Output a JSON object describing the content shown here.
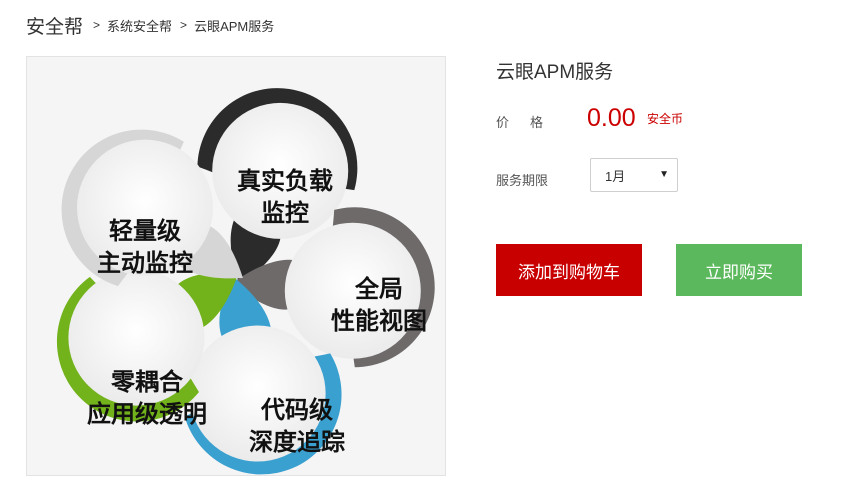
{
  "breadcrumb": {
    "home": "安全帮",
    "separator": ">",
    "category": "系统安全帮",
    "current": "云眼APM服务"
  },
  "product_image": {
    "petals": [
      {
        "line1": "真实负载",
        "line2": "监控",
        "ring_color": "#2b2b2b"
      },
      {
        "line1": "全局",
        "line2": "性能视图",
        "ring_color": "#6e6a6a"
      },
      {
        "line1": "代码级",
        "line2": "深度追踪",
        "ring_color": "#3aa0d0"
      },
      {
        "line1": "零耦合",
        "line2": "应用级透明",
        "ring_color": "#72b21a"
      },
      {
        "line1": "轻量级",
        "line2": "主动监控",
        "ring_color": "#d6d6d6"
      }
    ]
  },
  "product": {
    "title": "云眼APM服务",
    "price_label_1": "价",
    "price_label_2": "格",
    "price": "0.00",
    "price_unit": "安全币",
    "period_label": "服务期限",
    "period_selected": "1月",
    "arrow_icon": "▼"
  },
  "actions": {
    "add_to_cart": "添加到购物车",
    "buy_now": "立即购买"
  },
  "colors": {
    "price": "#cc0000",
    "cart_button": "#c90000",
    "buy_button": "#5cb85c"
  }
}
